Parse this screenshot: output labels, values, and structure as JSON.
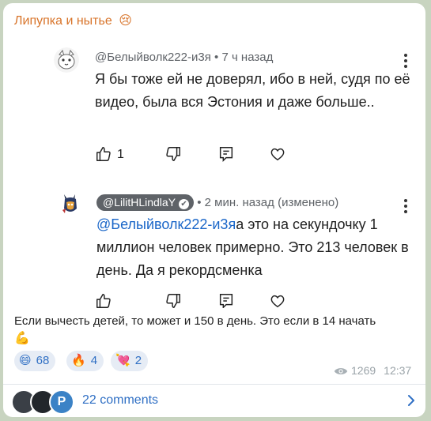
{
  "post": {
    "channel_title": "Липупка и нытье",
    "title_emoji": "😢",
    "caption": "Если вычесть детей, то может и 150 в день. Это если в 14 начать",
    "caption_emoji": "💪",
    "views": "1269",
    "time": "12:37"
  },
  "comments": [
    {
      "author": "@Белыйволк222-и3я",
      "separator": "•",
      "time": "7 ч назад",
      "text": "Я бы тоже ей не доверял, ибо в ней, судя по её видео, была вся Эстония и даже больше..",
      "likes": "1"
    },
    {
      "author": "@LilitHLindlaY",
      "separator": "•",
      "time": "2 мин. назад (изменено)",
      "mention": "@Белыйволк222-и3я",
      "text": "а это на секундочку 1 миллион человек примерно. Это 213 человек в день. Да я рекордсменка"
    }
  ],
  "reactions": [
    {
      "emoji": "😄",
      "count": "68"
    },
    {
      "emoji": "🔥",
      "count": "4"
    },
    {
      "emoji": "💘",
      "count": "2"
    }
  ],
  "footer": {
    "comments_label": "22 comments"
  },
  "icons": {
    "like": "thumb-up-icon",
    "dislike": "thumb-down-icon",
    "reply": "reply-icon",
    "heart": "heart-icon",
    "menu": "kebab-menu-icon",
    "views": "eye-icon",
    "chevron": "chevron-right-icon"
  },
  "colors": {
    "channel_title": "#d8742a",
    "link": "#2f6fc4",
    "mention": "#1a66c8",
    "reaction_bg": "#e6ecf5",
    "meta": "#5f6368"
  }
}
